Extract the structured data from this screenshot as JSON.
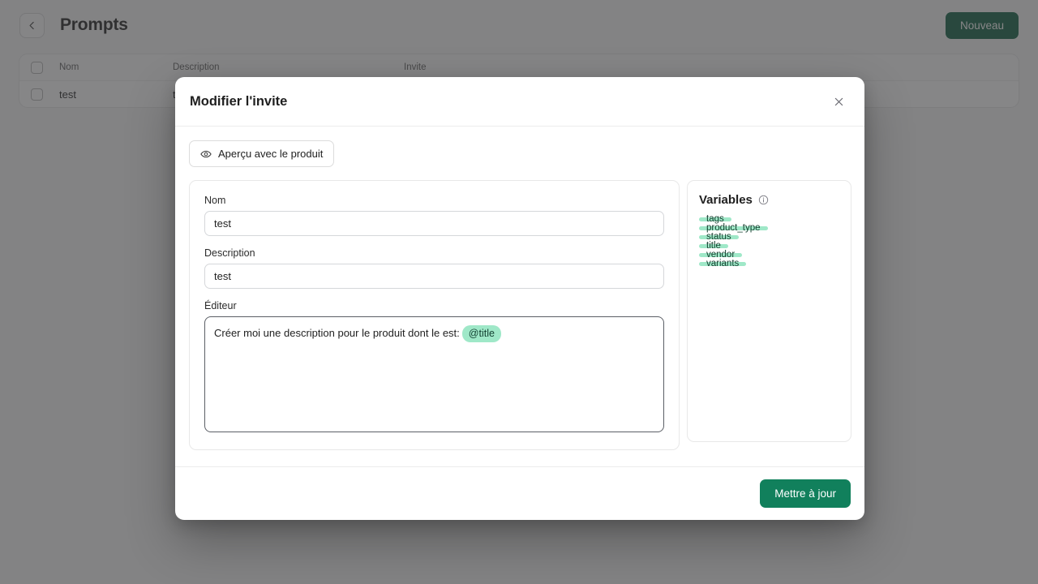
{
  "page": {
    "title": "Prompts",
    "back_icon": "arrow-left-icon",
    "new_button": "Nouveau"
  },
  "table": {
    "columns": [
      "Nom",
      "Description",
      "Invite"
    ],
    "rows": [
      {
        "nom": "test",
        "description": "t",
        "invite": ""
      }
    ]
  },
  "modal": {
    "title": "Modifier l'invite",
    "close_icon": "close-icon",
    "preview_button": {
      "label": "Aperçu avec le produit",
      "icon": "eye-icon"
    },
    "form": {
      "name_label": "Nom",
      "name_value": "test",
      "description_label": "Description",
      "description_value": "test",
      "editor_label": "Éditeur",
      "editor_text": "Créer moi une description pour le produit dont le est:",
      "editor_chip": "@title"
    },
    "variables": {
      "title": "Variables",
      "info_icon": "info-circle-icon",
      "items": [
        "tags",
        "product_type",
        "status",
        "title",
        "vendor",
        "variants"
      ]
    },
    "submit_button": "Mettre à jour"
  },
  "colors": {
    "brand_dark_green": "#0d5c3f",
    "brand_green": "#11805c",
    "chip_mint": "#9fe8c8",
    "overlay": "#3c3c3e"
  }
}
